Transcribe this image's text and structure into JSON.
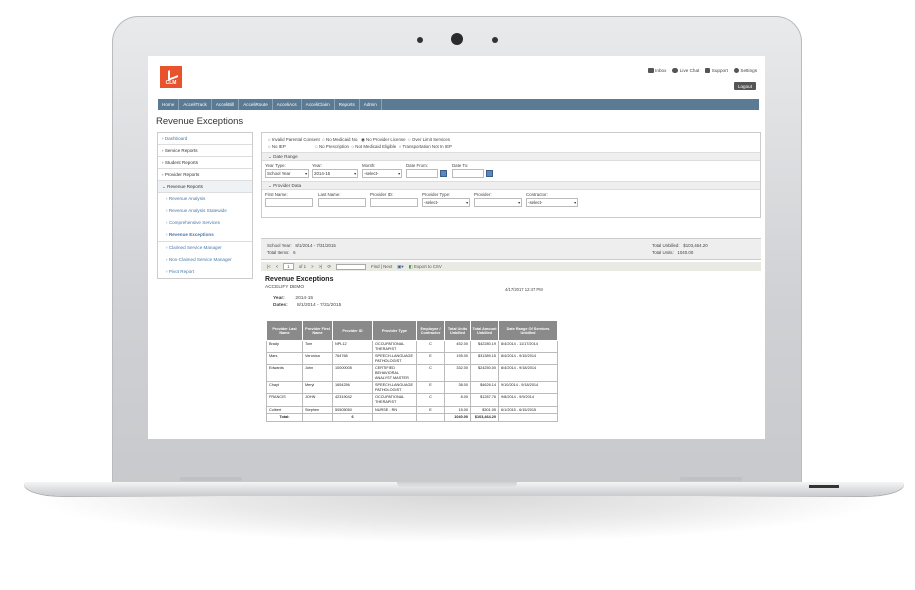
{
  "header": {
    "logo_text": "CLM",
    "links": [
      {
        "label": "Inbox",
        "icon": "envelope-icon"
      },
      {
        "label": "Live Chat",
        "icon": "chat-icon"
      },
      {
        "label": "Support",
        "icon": "support-icon"
      },
      {
        "label": "Settings",
        "icon": "gear-icon"
      }
    ],
    "logout": "Logout"
  },
  "nav": [
    "Home",
    "AcceliTrack",
    "AcceliBill",
    "AcceliRoute",
    "AcceliAcs",
    "AcceliClaim",
    "Reports",
    "Admin"
  ],
  "page_title": "Revenue Exceptions",
  "sidebar": [
    "Dashboard",
    "Service Reports",
    "Student Reports",
    "Provider Reports",
    "Revenue Reports"
  ],
  "sidebar_sub": [
    "Revenue Analysis",
    "Revenue Analysis Statewide",
    "Comprehensive Services",
    "Revenue Exceptions",
    "Claimed Service Manager",
    "Non-Claimed Service Manager",
    "Pivot Report"
  ],
  "filters": {
    "checks_row1": [
      "Invalid Parental Consent",
      "No Medicaid No.",
      "No Provider License",
      "Over Limit Services"
    ],
    "checks_row2": [
      "No IEP",
      "No Prescription",
      "Not Medicaid Eligible",
      "Transportation Not In IEP"
    ],
    "date_range": "Date Range",
    "year_type_label": "Year Type:",
    "year_type": "School Year",
    "year_label": "Year:",
    "year": "2014-15",
    "month_label": "Month:",
    "month": "-select-",
    "date_from_label": "Date From:",
    "date_to_label": "Date To:",
    "provider_data": "Provider Data",
    "first_name_label": "First Name:",
    "last_name_label": "Last Name:",
    "provider_id_label": "Provider ID:",
    "provider_type_label": "Provider Type:",
    "provider_type": "-select-",
    "provider_label": "Provider:",
    "contractor_label": "Contractor:",
    "contractor": "-select-"
  },
  "summary": {
    "school_year_label": "School Year:",
    "school_year": "8/1/2014 - 7/31/2015",
    "total_items_label": "Total Items:",
    "total_items": "6",
    "total_unbilled_label": "Total Unbilled:",
    "total_unbilled": "$103,464.20",
    "total_units_label": "Total Units:",
    "total_units": "1040.00"
  },
  "pager": {
    "first": "|<",
    "prev": "<",
    "page": "1",
    "of": "of 1",
    "next": ">",
    "last": ">|",
    "find": "Find | Next",
    "export": "Export to CSV"
  },
  "report": {
    "title": "Revenue Exceptions",
    "org": "ACCELIFY DEMO",
    "timestamp": "4/17/2017 12:47 PM",
    "year_label": "Year:",
    "year": "2014-15",
    "dates_label": "Dates:",
    "dates": "8/1/2014 - 7/31/2015"
  },
  "table": {
    "headers": [
      "Provider Last Name",
      "Provider First Name",
      "Provider ID",
      "Provider Type",
      "Employee / Contractor",
      "Total Units Unbilled",
      "Total Amount Unbilled",
      "Date Range Of Services Unbilled"
    ],
    "rows": [
      [
        "Brady",
        "Tom",
        "NPL12",
        "OCCUPATIONAL THERAPIST",
        "C",
        "452.00",
        "$42280.19",
        "8/4/2014 - 11/17/2014"
      ],
      [
        "Mars",
        "Veronica",
        "764768",
        "SPEECH-LANGUAGE PATHOLOGIST",
        "E",
        "195.00",
        "$31389.15",
        "8/4/2014 - 9/15/2014"
      ],
      [
        "Edwards",
        "John",
        "10000005",
        "CERTIFIED BEHAVIORAL ANALYST MASTER",
        "C",
        "332.00",
        "$24250.00",
        "8/4/2014 - 9/18/2014"
      ],
      [
        "Chayt",
        "Meryl",
        "1654256",
        "SPEECH-LANGUAGE PATHOLOGIST",
        "E",
        "38.00",
        "$4626.14",
        "9/10/2014 - 9/18/2014"
      ],
      [
        "FRANCIS",
        "JOHN",
        "42319042",
        "OCCUPATIONAL THERAPIST",
        "C",
        "8.00",
        "$1287.76",
        "9/8/2014 - 9/9/2014"
      ],
      [
        "Colbert",
        "Stephen",
        "50505050",
        "NURSE - RN",
        "E",
        "15.00",
        "$301.05",
        "6/1/2015 - 6/15/2015"
      ]
    ],
    "total": {
      "label": "Total:",
      "count": "6",
      "units": "1040.00",
      "amount": "$103,464.20"
    }
  }
}
